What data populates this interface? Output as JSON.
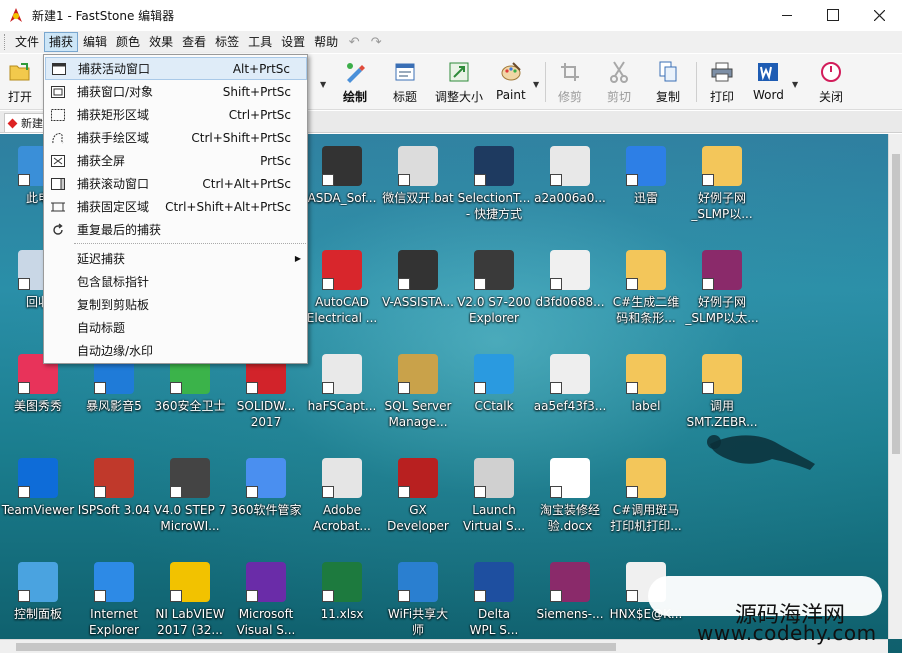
{
  "window": {
    "title": "新建1 - FastStone 编辑器"
  },
  "menubar": {
    "items": [
      "文件",
      "捕获",
      "编辑",
      "颜色",
      "效果",
      "查看",
      "标签",
      "工具",
      "设置",
      "帮助"
    ],
    "active": "捕获"
  },
  "toolbar": {
    "open": "打开",
    "draw": "绘制",
    "caption": "标题",
    "resize": "调整大小",
    "paint": "Paint",
    "crop": "修剪",
    "cut": "剪切",
    "copy": "复制",
    "print": "打印",
    "word": "Word",
    "close": "关闭"
  },
  "tab": {
    "label": "新建"
  },
  "capture_menu": {
    "items": [
      {
        "label": "捕获活动窗口",
        "shortcut": "Alt+PrtSc",
        "icon": "window-icon"
      },
      {
        "label": "捕获窗口/对象",
        "shortcut": "Shift+PrtSc",
        "icon": "object-icon"
      },
      {
        "label": "捕获矩形区域",
        "shortcut": "Ctrl+PrtSc",
        "icon": "rectangle-icon"
      },
      {
        "label": "捕获手绘区域",
        "shortcut": "Ctrl+Shift+PrtSc",
        "icon": "freehand-icon"
      },
      {
        "label": "捕获全屏",
        "shortcut": "PrtSc",
        "icon": "fullscreen-icon"
      },
      {
        "label": "捕获滚动窗口",
        "shortcut": "Ctrl+Alt+PrtSc",
        "icon": "scroll-icon"
      },
      {
        "label": "捕获固定区域",
        "shortcut": "Ctrl+Shift+Alt+PrtSc",
        "icon": "fixed-region-icon"
      },
      {
        "label": "重复最后的捕获",
        "shortcut": "",
        "icon": "repeat-icon"
      }
    ],
    "options": [
      {
        "label": "延迟捕获",
        "submenu": true
      },
      {
        "label": "包含鼠标指针"
      },
      {
        "label": "复制到剪贴板"
      },
      {
        "label": "自动标题"
      },
      {
        "label": "自动边缘/水印"
      }
    ]
  },
  "desktop": {
    "icons": [
      {
        "l1": "此电",
        "l2": "",
        "color": "#3a8fd8"
      },
      {
        "l1": "回收",
        "l2": "",
        "color": "#c9d7e6"
      },
      {
        "l1": "美图秀秀",
        "l2": "",
        "color": "#e8335a"
      },
      {
        "l1": "TeamViewer",
        "l2": "",
        "color": "#0e6cd8"
      },
      {
        "l1": "控制面板",
        "l2": "",
        "color": "#4aa3e0"
      },
      {
        "l1": "暴风影音5",
        "l2": "",
        "color": "#1f7bd8"
      },
      {
        "l1": "ISPSoft 3.04",
        "l2": "",
        "color": "#c0392b"
      },
      {
        "l1": "Internet",
        "l2": "Explorer",
        "color": "#2d8ae6"
      },
      {
        "l1": "360安全卫士",
        "l2": "",
        "color": "#3bb34a"
      },
      {
        "l1": "V4.0 STEP 7",
        "l2": "MicroWI...",
        "color": "#444444"
      },
      {
        "l1": "NI LabVIEW",
        "l2": "2017 (32...",
        "color": "#f2c200"
      },
      {
        "l1": "SOLIDW...",
        "l2": "2017",
        "color": "#d2232a"
      },
      {
        "l1": "360软件管家",
        "l2": "",
        "color": "#4a8ff0"
      },
      {
        "l1": "Microsoft",
        "l2": "Visual S...",
        "color": "#6a2ca8"
      },
      {
        "l1": "ASDA_Sof...",
        "l2": "",
        "color": "#333333"
      },
      {
        "l1": "AutoCAD",
        "l2": "Electrical ...",
        "color": "#d8262c"
      },
      {
        "l1": "haFSCapt...",
        "l2": "",
        "color": "#e9e9e9"
      },
      {
        "l1": "Adobe",
        "l2": "Acrobat...",
        "color": "#e5e5e5"
      },
      {
        "l1": "11.xlsx",
        "l2": "",
        "color": "#1d7a3e"
      },
      {
        "l1": "微信双开.bat",
        "l2": "",
        "color": "#dcdcdc"
      },
      {
        "l1": "V-ASSISTA...",
        "l2": "",
        "color": "#333333"
      },
      {
        "l1": "SQL Server",
        "l2": "Manage...",
        "color": "#c9a24a"
      },
      {
        "l1": "GX",
        "l2": "Developer",
        "color": "#b82020"
      },
      {
        "l1": "WiFi共享大",
        "l2": "师",
        "color": "#2a7fd0"
      },
      {
        "l1": "SelectionT...",
        "l2": "- 快捷方式",
        "color": "#1e3a60"
      },
      {
        "l1": "V2.0 S7-200",
        "l2": "Explorer",
        "color": "#3a3a3a"
      },
      {
        "l1": "CCtalk",
        "l2": "",
        "color": "#2a9ae0"
      },
      {
        "l1": "Launch",
        "l2": "Virtual S...",
        "color": "#d0d0d0"
      },
      {
        "l1": "Delta",
        "l2": "WPL S...",
        "color": "#1e4fa0"
      },
      {
        "l1": "a2a006a0...",
        "l2": "",
        "color": "#e8e8e8"
      },
      {
        "l1": "d3fd0688...",
        "l2": "",
        "color": "#f0f0f0"
      },
      {
        "l1": "aa5ef43f3...",
        "l2": "",
        "color": "#eeeeee"
      },
      {
        "l1": "淘宝装修经",
        "l2": "验.docx",
        "color": "#ffffff"
      },
      {
        "l1": "Siemens-...",
        "l2": "",
        "color": "#8a2a6a"
      },
      {
        "l1": "迅雷",
        "l2": "",
        "color": "#2d7fe6"
      },
      {
        "l1": "C#生成二维",
        "l2": "码和条形...",
        "color": "#f3c65a"
      },
      {
        "l1": "label",
        "l2": "",
        "color": "#f3c65a"
      },
      {
        "l1": "C#调用斑马",
        "l2": "打印机打印...",
        "color": "#f3c65a"
      },
      {
        "l1": "HNX$E@K...",
        "l2": "",
        "color": "#f0f0f0"
      },
      {
        "l1": "好例子网",
        "l2": "_SLMP以...",
        "color": "#f3c65a"
      },
      {
        "l1": "好例子网",
        "l2": "_SLMP以太...",
        "color": "#8a2a6a"
      },
      {
        "l1": "调用",
        "l2": "SMT.ZEBR...",
        "color": "#f3c65a"
      }
    ]
  },
  "watermark": {
    "title": "源码海洋网",
    "url": "www.codehy.com"
  }
}
